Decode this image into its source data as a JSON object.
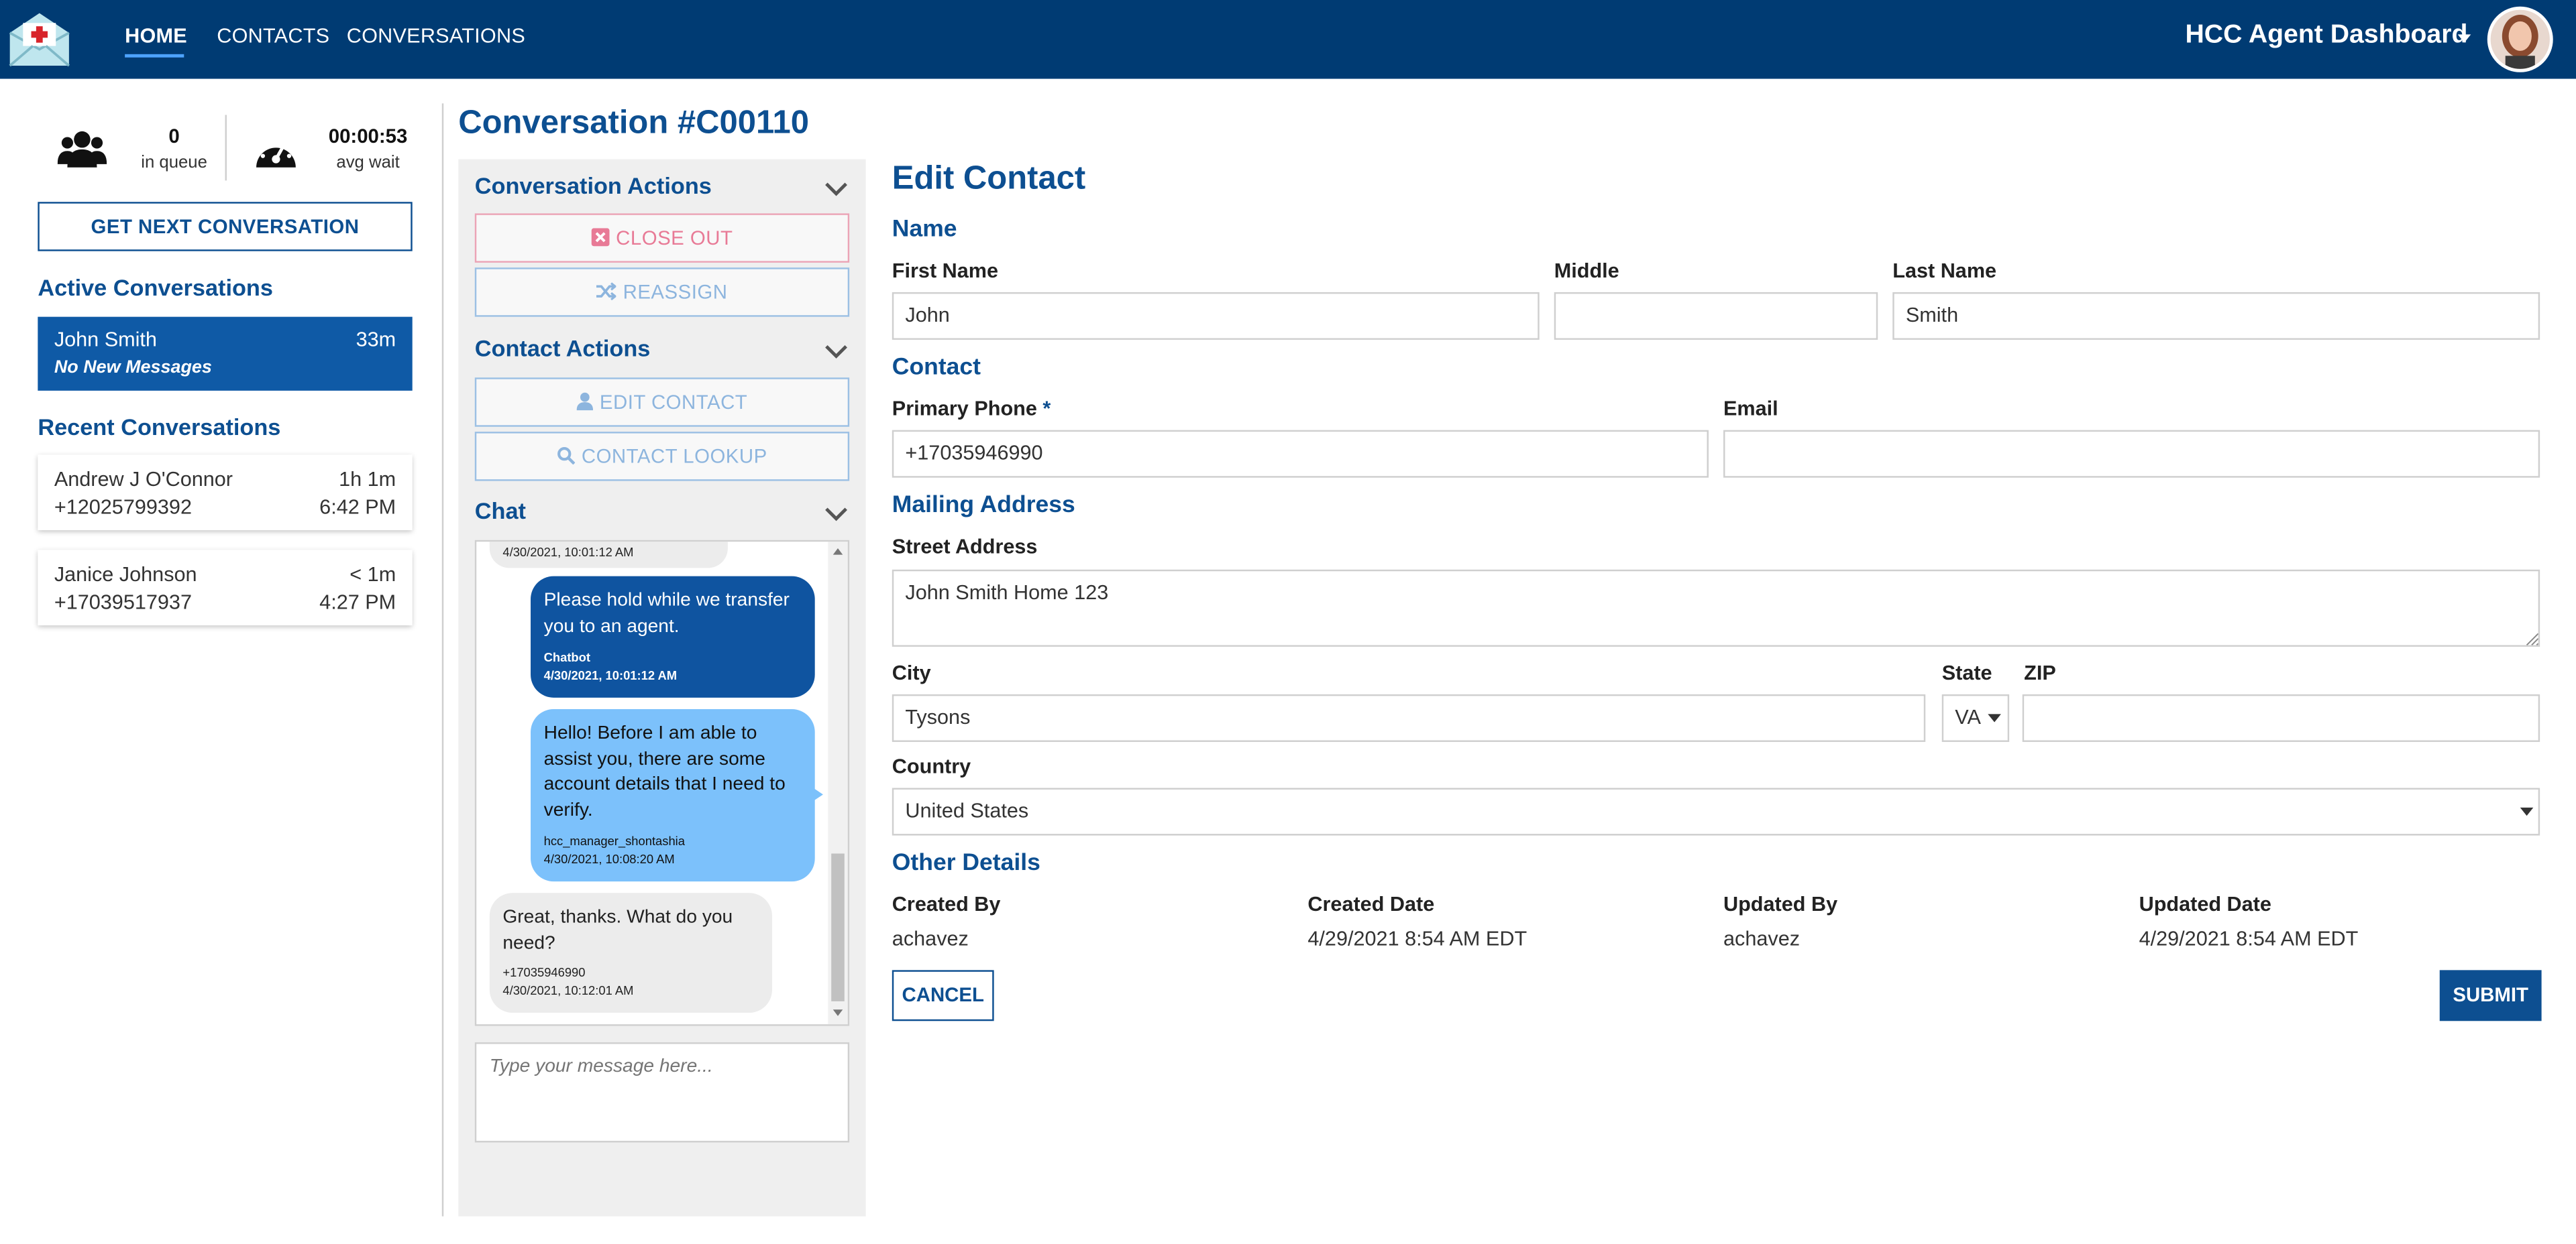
{
  "nav": {
    "home": "HOME",
    "contacts": "CONTACTS",
    "conversations": "CONVERSATIONS",
    "dashboard_title": "HCC Agent Dashboard"
  },
  "stats": {
    "queue_count": "0",
    "queue_label": "in queue",
    "wait_time": "00:00:53",
    "wait_label": "avg wait"
  },
  "sidebar": {
    "get_next_label": "GET NEXT CONVERSATION",
    "active_title": "Active Conversations",
    "active": [
      {
        "name": "John Smith",
        "time": "33m",
        "subtitle": "No New Messages"
      }
    ],
    "recent_title": "Recent Conversations",
    "recent": [
      {
        "name": "Andrew J O'Connor",
        "phone": "+12025799392",
        "age": "1h 1m",
        "time": "6:42 PM"
      },
      {
        "name": "Janice Johnson",
        "phone": "+17039517937",
        "age": "< 1m",
        "time": "4:27 PM"
      }
    ]
  },
  "conversation": {
    "title": "Conversation #C00110"
  },
  "actions": {
    "conversation_title": "Conversation Actions",
    "close_out": "CLOSE OUT",
    "reassign": "REASSIGN",
    "contact_title": "Contact Actions",
    "edit_contact": "EDIT CONTACT",
    "contact_lookup": "CONTACT LOOKUP"
  },
  "chat": {
    "title": "Chat",
    "partial_top": "4/30/2021, 10:01:12 AM",
    "messages": [
      {
        "kind": "bot",
        "text": "Please hold while we transfer you to an agent.",
        "sender": "Chatbot",
        "timestamp": "4/30/2021, 10:01:12 AM"
      },
      {
        "kind": "agent",
        "text": "Hello! Before I am able to assist you, there are some account details that I need to verify.",
        "sender": "hcc_manager_shontashia",
        "timestamp": "4/30/2021, 10:08:20 AM"
      },
      {
        "kind": "user",
        "text": "Great, thanks. What do you need?",
        "sender": "+17035946990",
        "timestamp": "4/30/2021, 10:12:01 AM"
      }
    ],
    "input_placeholder": "Type your message here..."
  },
  "form": {
    "title": "Edit Contact",
    "name_section": "Name",
    "first_name_label": "First Name",
    "first_name": "John",
    "middle_label": "Middle",
    "middle": "",
    "last_name_label": "Last Name",
    "last_name": "Smith",
    "contact_section": "Contact",
    "phone_label": "Primary Phone",
    "phone_required": "*",
    "phone": "+17035946990",
    "email_label": "Email",
    "email": "",
    "mailing_section": "Mailing Address",
    "street_label": "Street Address",
    "street": "John Smith Home 123",
    "city_label": "City",
    "city": "Tysons",
    "state_label": "State",
    "state": "VA",
    "zip_label": "ZIP",
    "zip": "",
    "country_label": "Country",
    "country": "United States",
    "other_section": "Other Details",
    "created_by_label": "Created By",
    "created_by": "achavez",
    "created_date_label": "Created Date",
    "created_date": "4/29/2021 8:54 AM EDT",
    "updated_by_label": "Updated By",
    "updated_by": "achavez",
    "updated_date_label": "Updated Date",
    "updated_date": "4/29/2021 8:54 AM EDT",
    "cancel_label": "CANCEL",
    "submit_label": "SUBMIT"
  },
  "colors": {
    "nav_bg": "#003b73",
    "brand_blue": "#0d4f91",
    "active_card": "#0f5aa6",
    "agent_bubble": "#7cc1fb",
    "danger": "#e87a96"
  }
}
